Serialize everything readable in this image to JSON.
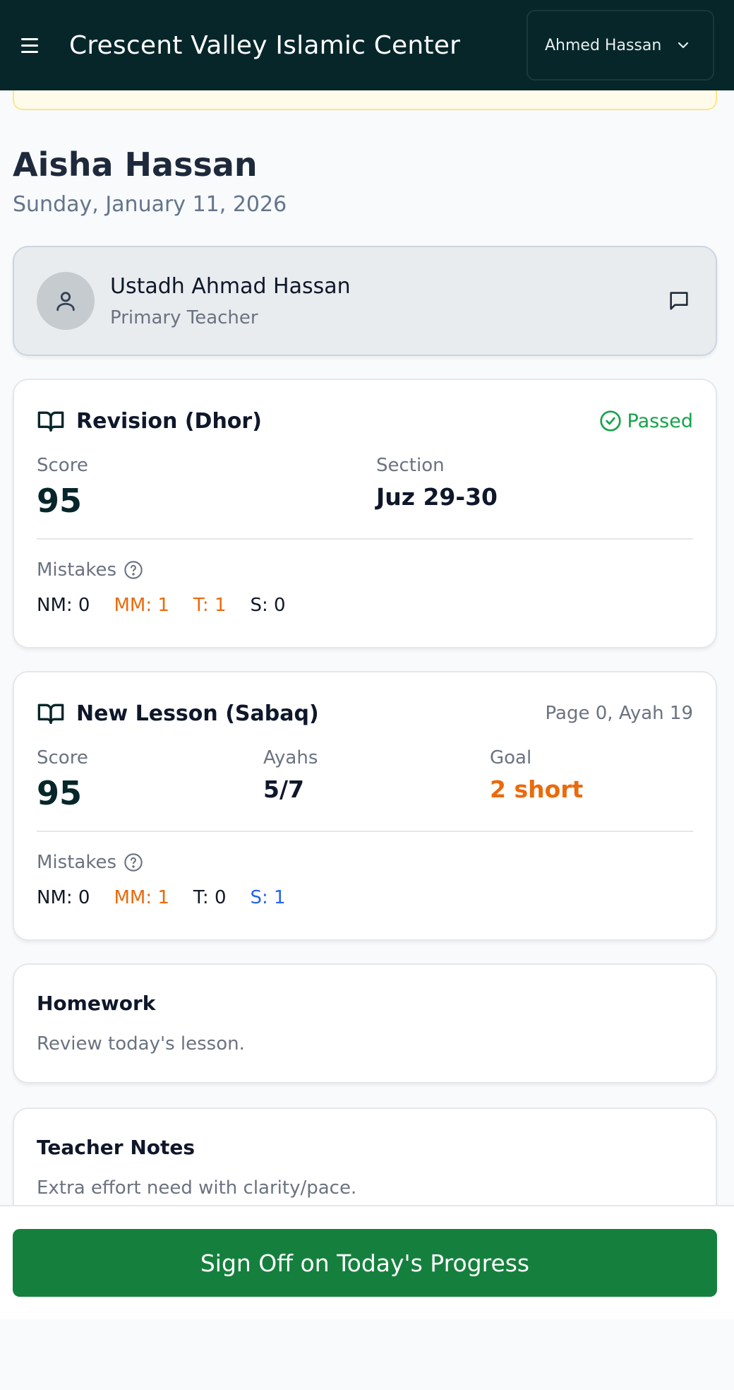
{
  "header": {
    "app_title": "Crescent Valley Islamic Center",
    "user_name": "Ahmed Hassan"
  },
  "student": {
    "name": "Aisha Hassan",
    "date": "Sunday, January 11, 2026"
  },
  "teacher": {
    "name": "Ustadh Ahmad Hassan",
    "role": "Primary Teacher"
  },
  "revision": {
    "title": "Revision (Dhor)",
    "status": "Passed",
    "score_label": "Score",
    "score": "95",
    "section_label": "Section",
    "section": "Juz 29-30",
    "mistakes_label": "Mistakes",
    "mistakes": [
      "NM: 0",
      "MM: 1",
      "T: 1",
      "S: 0"
    ]
  },
  "lesson": {
    "title": "New Lesson (Sabaq)",
    "page_ref": "Page 0, Ayah 19",
    "score_label": "Score",
    "score": "95",
    "ayahs_label": "Ayahs",
    "ayahs": "5/7",
    "goal_label": "Goal",
    "goal": "2 short",
    "mistakes_label": "Mistakes",
    "mistakes": [
      "NM: 0",
      "MM: 1",
      "T: 0",
      "S: 1"
    ]
  },
  "homework": {
    "title": "Homework",
    "body": "Review today's lesson."
  },
  "notes": {
    "title": "Teacher Notes",
    "body": "Extra effort need with clarity/pace."
  },
  "footer": {
    "signoff_label": "Sign Off on Today's Progress"
  },
  "colors": {
    "header_bg": "#06262a",
    "accent_green": "#15803d",
    "passed_green": "#16a34a",
    "warning_orange": "#ea6a0c",
    "info_blue": "#2563eb"
  },
  "icons": [
    "menu-icon",
    "chevron-down-icon",
    "user-icon",
    "message-icon",
    "book-open-icon",
    "check-circle-icon",
    "help-circle-icon"
  ]
}
